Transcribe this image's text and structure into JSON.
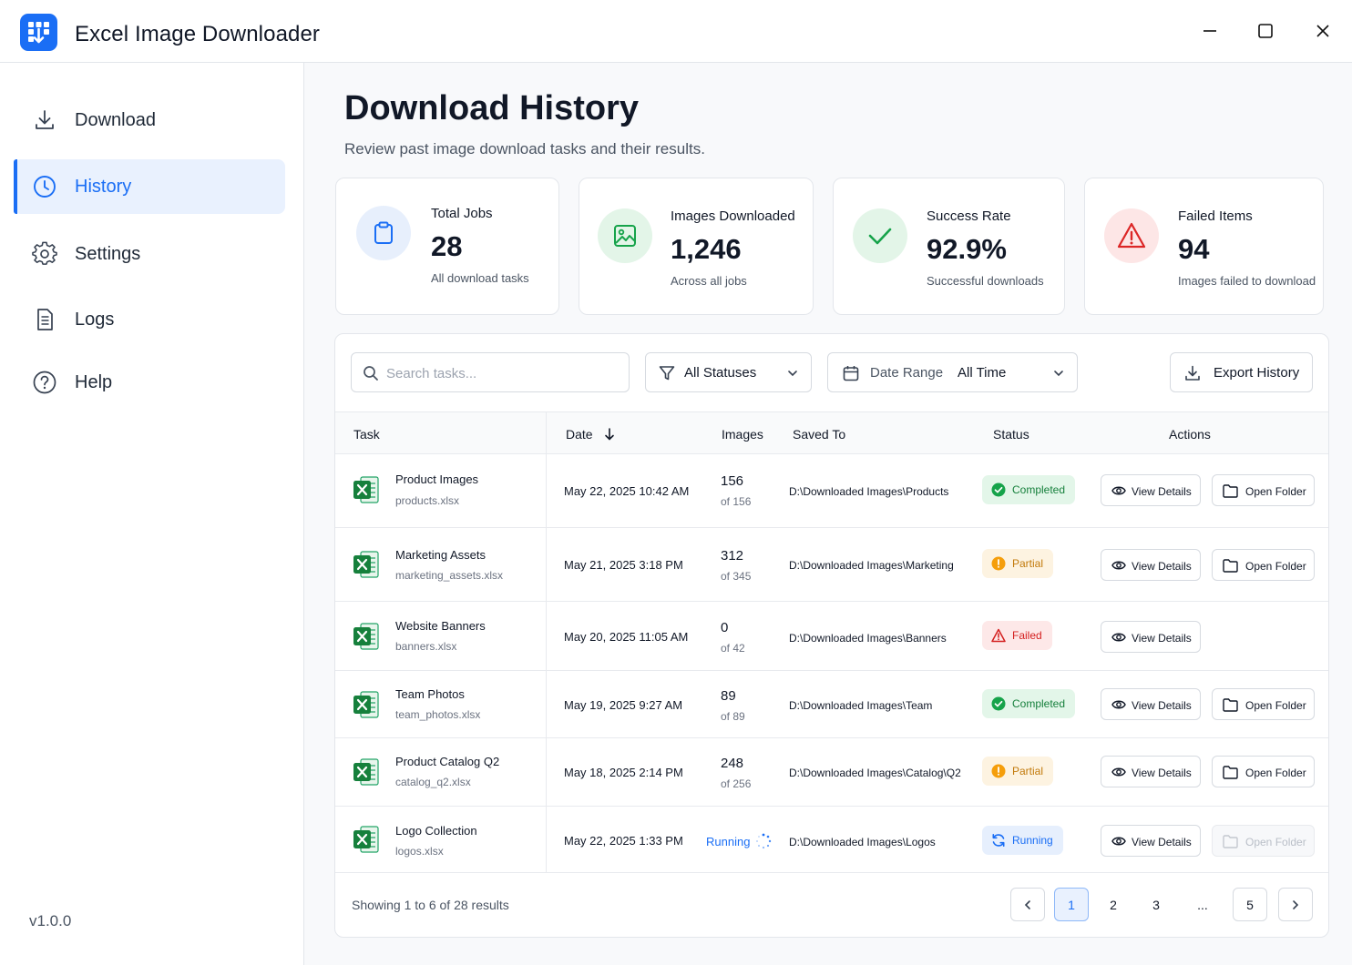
{
  "app": {
    "title": "Excel Image Downloader",
    "version": "v1.0.0"
  },
  "sidebar": {
    "items": [
      {
        "label": "Download",
        "icon": "download-icon"
      },
      {
        "label": "History",
        "icon": "clock-icon",
        "active": true
      },
      {
        "label": "Settings",
        "icon": "gear-icon"
      },
      {
        "label": "Logs",
        "icon": "document-icon"
      },
      {
        "label": "Help",
        "icon": "help-circle-icon"
      }
    ]
  },
  "page": {
    "title": "Download History",
    "subtitle": "Review past image download tasks and their results."
  },
  "stats": [
    {
      "label": "Total Jobs",
      "value": "28",
      "sub": "All download tasks",
      "icon": "clipboard-icon",
      "color": "#1a6ef5"
    },
    {
      "label": "Images Downloaded",
      "value": "1,246",
      "sub": "Across all jobs",
      "icon": "image-icon",
      "color": "#16a34a"
    },
    {
      "label": "Success Rate",
      "value": "92.9%",
      "sub": "Successful downloads",
      "icon": "check-icon",
      "color": "#16a34a"
    },
    {
      "label": "Failed Items",
      "value": "94",
      "sub": "Images failed to download",
      "icon": "warning-icon",
      "color": "#dc2626"
    }
  ],
  "toolbar": {
    "search_placeholder": "Search tasks...",
    "status_filter": "All Statuses",
    "date_range_label": "Date Range",
    "date_range_value": "All Time",
    "export_label": "Export History"
  },
  "table": {
    "headers": {
      "task": "Task",
      "date": "Date",
      "images": "Images",
      "saved_to": "Saved To",
      "status": "Status",
      "actions": "Actions"
    },
    "view_label": "View Details",
    "open_label": "Open Folder",
    "rows": [
      {
        "name": "Product Images",
        "file": "products.xlsx",
        "date": "May 22, 2025 10:42 AM",
        "count": "156",
        "total": "of 156",
        "path": "D:\\Downloaded Images\\Products",
        "status": "Completed"
      },
      {
        "name": "Marketing Assets",
        "file": "marketing_assets.xlsx",
        "date": "May 21, 2025 3:18 PM",
        "count": "312",
        "total": "of 345",
        "path": "D:\\Downloaded Images\\Marketing",
        "status": "Partial"
      },
      {
        "name": "Website Banners",
        "file": "banners.xlsx",
        "date": "May 20, 2025 11:05 AM",
        "count": "0",
        "total": "of 42",
        "path": "D:\\Downloaded Images\\Banners",
        "status": "Failed"
      },
      {
        "name": "Team Photos",
        "file": "team_photos.xlsx",
        "date": "May 19, 2025 9:27 AM",
        "count": "89",
        "total": "of 89",
        "path": "D:\\Downloaded Images\\Team",
        "status": "Completed"
      },
      {
        "name": "Product Catalog Q2",
        "file": "catalog_q2.xlsx",
        "date": "May 18, 2025 2:14 PM",
        "count": "248",
        "total": "of 256",
        "path": "D:\\Downloaded Images\\Catalog\\Q2",
        "status": "Partial"
      },
      {
        "name": "Logo Collection",
        "file": "logos.xlsx",
        "date": "May 22, 2025 1:33 PM",
        "running": "Running",
        "path": "D:\\Downloaded Images\\Logos",
        "status": "Running"
      }
    ]
  },
  "pagination": {
    "info": "Showing 1 to 6 of 28 results",
    "pages": [
      "1",
      "2",
      "3",
      "...",
      "5"
    ],
    "current": "1"
  },
  "colors": {
    "accent": "#1a6ef5",
    "success": "#16803c",
    "warning": "#c27a0b",
    "danger": "#d42020"
  }
}
